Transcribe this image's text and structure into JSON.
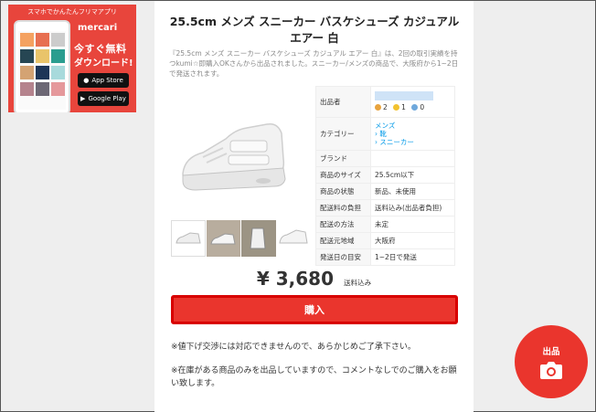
{
  "ad": {
    "tagline": "スマホでかんたんフリマアプリ",
    "brand": "mercari",
    "line1": "今すぐ無料",
    "line2": "ダウンロード!",
    "app_store": "App Store",
    "google_play": "Google Play"
  },
  "item": {
    "title": "25.5cm メンズ スニーカー バスケシューズ カジュアル エアー 白",
    "description": "『25.5cm メンズ スニーカー バスケシューズ カジュアル エアー 白』は、2回の取引実績を持つkumi☆即購入OKさんから出品されました。スニーカー/メンズの商品で、大阪府から1~2日で発送されます。"
  },
  "details": {
    "seller_label": "出品者",
    "ratings": {
      "good": "2",
      "normal": "1",
      "bad": "0"
    },
    "category_label": "カテゴリー",
    "category": [
      "メンズ",
      "靴",
      "スニーカー"
    ],
    "brand_label": "ブランド",
    "brand": "",
    "size_label": "商品のサイズ",
    "size": "25.5cm以下",
    "condition_label": "商品の状態",
    "condition": "新品、未使用",
    "shipping_fee_label": "配送料の負担",
    "shipping_fee": "送料込み(出品者負担)",
    "shipping_method_label": "配送の方法",
    "shipping_method": "未定",
    "origin_label": "配送元地域",
    "origin": "大阪府",
    "days_label": "発送日の目安",
    "days": "1~2日で発送"
  },
  "price": {
    "amount": "¥ 3,680",
    "note": "送料込み"
  },
  "buy_label": "購入",
  "notes": [
    "※値下げ交渉には対応できませんので、あらかじめご了承下さい。",
    "※在庫がある商品のみを出品していますので、コメントなしでのご購入をお願い致します。"
  ],
  "fab_label": "出品",
  "colors": {
    "accent": "#ea352d",
    "link": "#0099e8"
  }
}
